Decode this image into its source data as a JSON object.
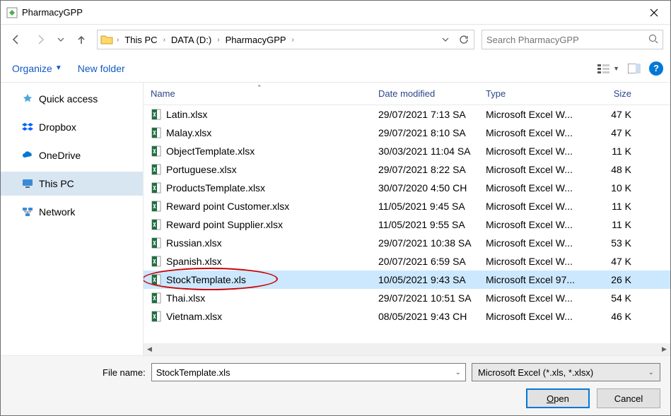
{
  "title": "PharmacyGPP",
  "breadcrumbs": [
    "This PC",
    "DATA (D:)",
    "PharmacyGPP"
  ],
  "search_placeholder": "Search PharmacyGPP",
  "toolbar": {
    "organize": "Organize",
    "new_folder": "New folder"
  },
  "sidebar": [
    {
      "label": "Quick access",
      "icon": "star"
    },
    {
      "label": "Dropbox",
      "icon": "dropbox"
    },
    {
      "label": "OneDrive",
      "icon": "onedrive"
    },
    {
      "label": "This PC",
      "icon": "pc",
      "selected": true
    },
    {
      "label": "Network",
      "icon": "network"
    }
  ],
  "columns": {
    "name": "Name",
    "date": "Date modified",
    "type": "Type",
    "size": "Size"
  },
  "files": [
    {
      "name": "Latin.xlsx",
      "date": "29/07/2021 7:13 SA",
      "type": "Microsoft Excel W...",
      "size": "47 K"
    },
    {
      "name": "Malay.xlsx",
      "date": "29/07/2021 8:10 SA",
      "type": "Microsoft Excel W...",
      "size": "47 K"
    },
    {
      "name": "ObjectTemplate.xlsx",
      "date": "30/03/2021 11:04 SA",
      "type": "Microsoft Excel W...",
      "size": "11 K"
    },
    {
      "name": "Portuguese.xlsx",
      "date": "29/07/2021 8:22 SA",
      "type": "Microsoft Excel W...",
      "size": "48 K"
    },
    {
      "name": "ProductsTemplate.xlsx",
      "date": "30/07/2020 4:50 CH",
      "type": "Microsoft Excel W...",
      "size": "10 K"
    },
    {
      "name": "Reward point Customer.xlsx",
      "date": "11/05/2021 9:45 SA",
      "type": "Microsoft Excel W...",
      "size": "11 K"
    },
    {
      "name": "Reward point Supplier.xlsx",
      "date": "11/05/2021 9:55 SA",
      "type": "Microsoft Excel W...",
      "size": "11 K"
    },
    {
      "name": "Russian.xlsx",
      "date": "29/07/2021 10:38 SA",
      "type": "Microsoft Excel W...",
      "size": "53 K"
    },
    {
      "name": "Spanish.xlsx",
      "date": "20/07/2021 6:59 SA",
      "type": "Microsoft Excel W...",
      "size": "47 K"
    },
    {
      "name": "StockTemplate.xls",
      "date": "10/05/2021 9:43 SA",
      "type": "Microsoft Excel 97...",
      "size": "26 K",
      "selected": true,
      "circled": true
    },
    {
      "name": "Thai.xlsx",
      "date": "29/07/2021 10:51 SA",
      "type": "Microsoft Excel W...",
      "size": "54 K"
    },
    {
      "name": "Vietnam.xlsx",
      "date": "08/05/2021 9:43 CH",
      "type": "Microsoft Excel W...",
      "size": "46 K"
    }
  ],
  "filename_label": "File name:",
  "filename_value": "StockTemplate.xls",
  "filter_value": "Microsoft Excel (*.xls, *.xlsx)",
  "buttons": {
    "open": "Open",
    "cancel": "Cancel"
  }
}
